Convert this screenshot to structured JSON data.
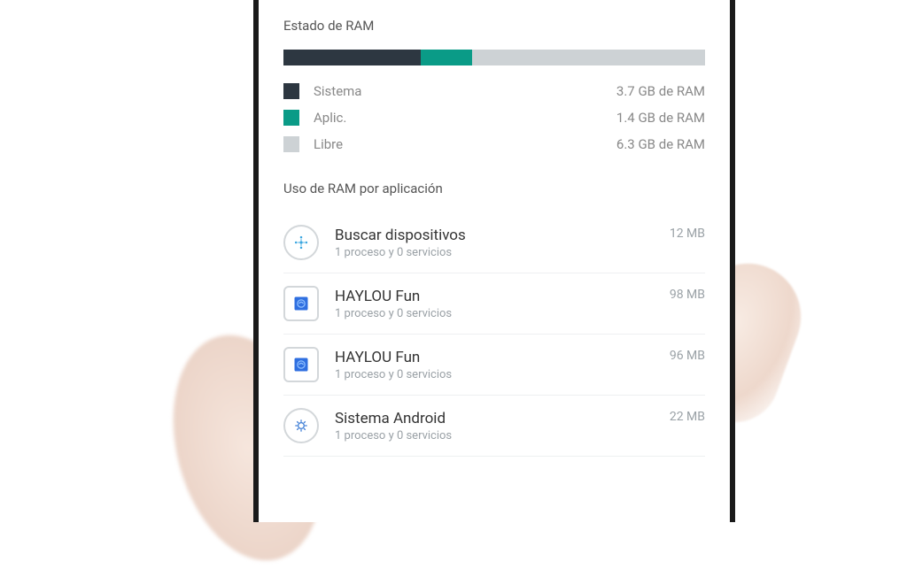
{
  "ram_status": {
    "title": "Estado de RAM",
    "segments": {
      "system": {
        "label": "Sistema",
        "value": "3.7 GB de RAM"
      },
      "apps": {
        "label": "Aplic.",
        "value": "1.4 GB de RAM"
      },
      "free": {
        "label": "Libre",
        "value": "6.3 GB de RAM"
      }
    }
  },
  "app_usage": {
    "title": "Uso de RAM por aplicación",
    "apps": [
      {
        "name": "Buscar dispositivos",
        "sub": "1 proceso y 0 servicios",
        "size": "12 MB",
        "icon": "find-devices"
      },
      {
        "name": "HAYLOU Fun",
        "sub": "1 proceso y 0 servicios",
        "size": "98 MB",
        "icon": "haylou"
      },
      {
        "name": "HAYLOU Fun",
        "sub": "1 proceso y 0 servicios",
        "size": "96 MB",
        "icon": "haylou"
      },
      {
        "name": "Sistema Android",
        "sub": "1 proceso y 0 servicios",
        "size": "22 MB",
        "icon": "android-system"
      }
    ]
  },
  "chart_data": {
    "type": "bar",
    "title": "Estado de RAM",
    "categories": [
      "Sistema",
      "Aplic.",
      "Libre"
    ],
    "values": [
      3.7,
      1.4,
      6.3
    ],
    "ylabel": "GB de RAM",
    "ylim": [
      0,
      11.4
    ]
  }
}
